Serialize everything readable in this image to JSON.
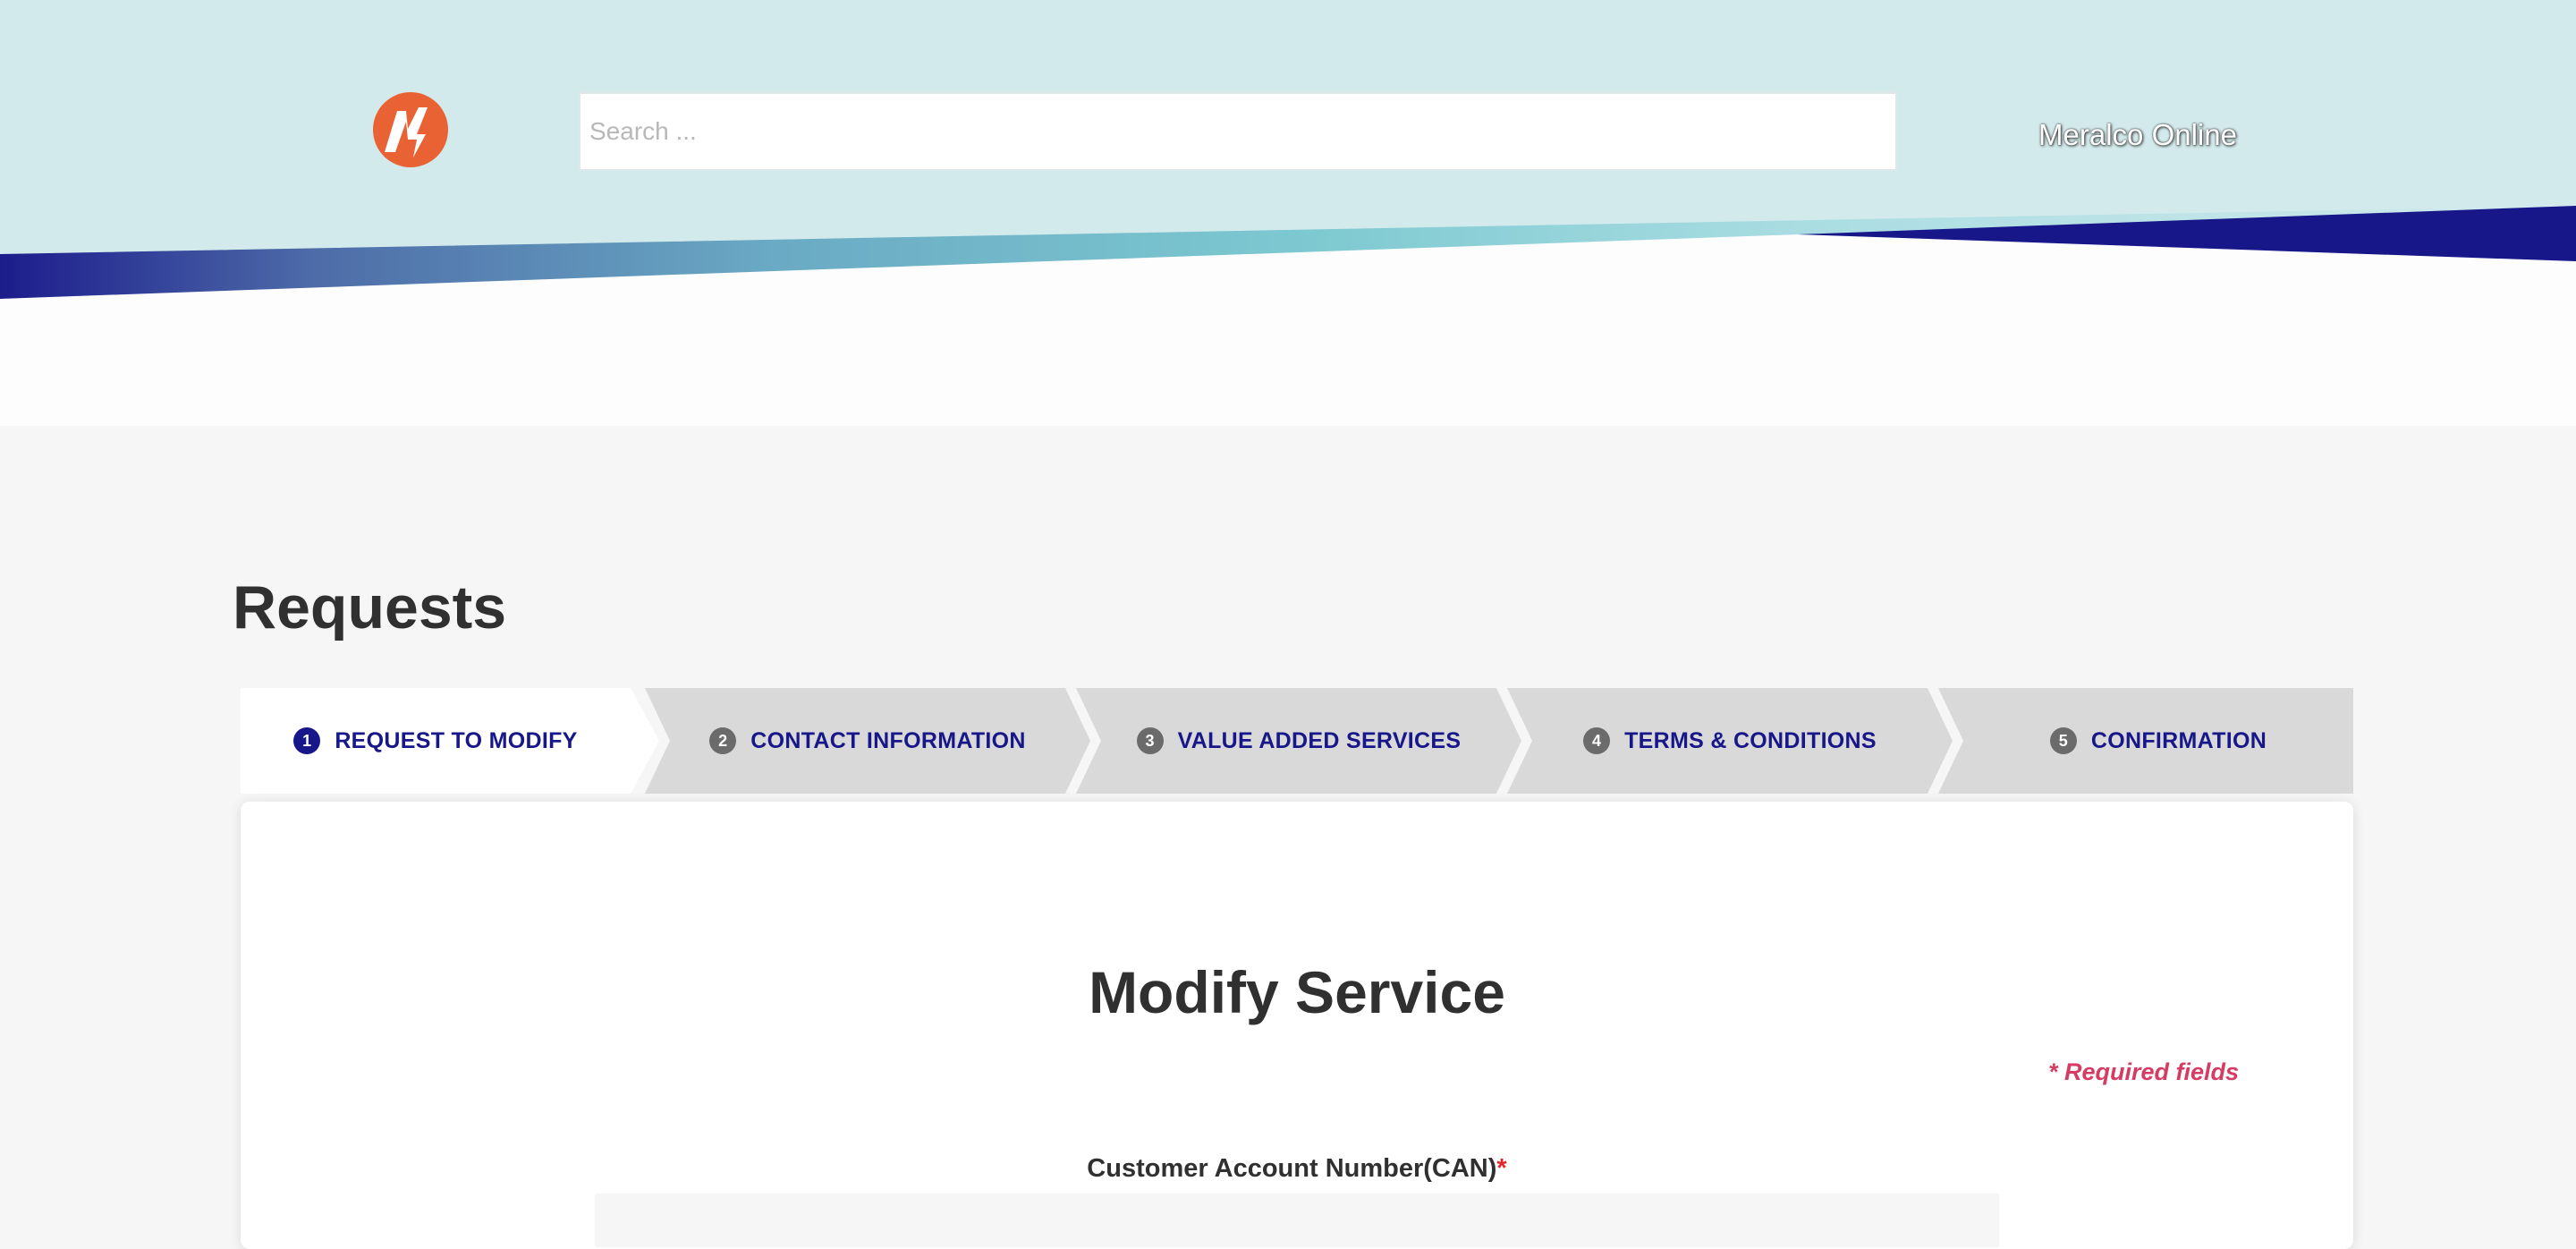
{
  "header": {
    "search_placeholder": "Search ...",
    "site_link": "Meralco Online",
    "logo_icon": "meralco-logo",
    "colors": {
      "band_background": "#d3eaec",
      "swoosh_dark": "#17178a",
      "swoosh_teal": "#7cc8d0",
      "logo_orange": "#e96233"
    }
  },
  "page": {
    "title": "Requests"
  },
  "stepper": {
    "steps": [
      {
        "number": "1",
        "label": "REQUEST TO MODIFY",
        "active": true
      },
      {
        "number": "2",
        "label": "CONTACT INFORMATION",
        "active": false
      },
      {
        "number": "3",
        "label": "VALUE ADDED SERVICES",
        "active": false
      },
      {
        "number": "4",
        "label": "TERMS & CONDITIONS",
        "active": false
      },
      {
        "number": "5",
        "label": "CONFIRMATION",
        "active": false
      }
    ],
    "colors": {
      "active_bg": "#ffffff",
      "inactive_bg": "#d9d9d9",
      "text": "#17178a"
    }
  },
  "form": {
    "title": "Modify Service",
    "required_note": "* Required fields",
    "can_label": "Customer Account Number(CAN)",
    "can_required_mark": "*",
    "can_value": ""
  }
}
